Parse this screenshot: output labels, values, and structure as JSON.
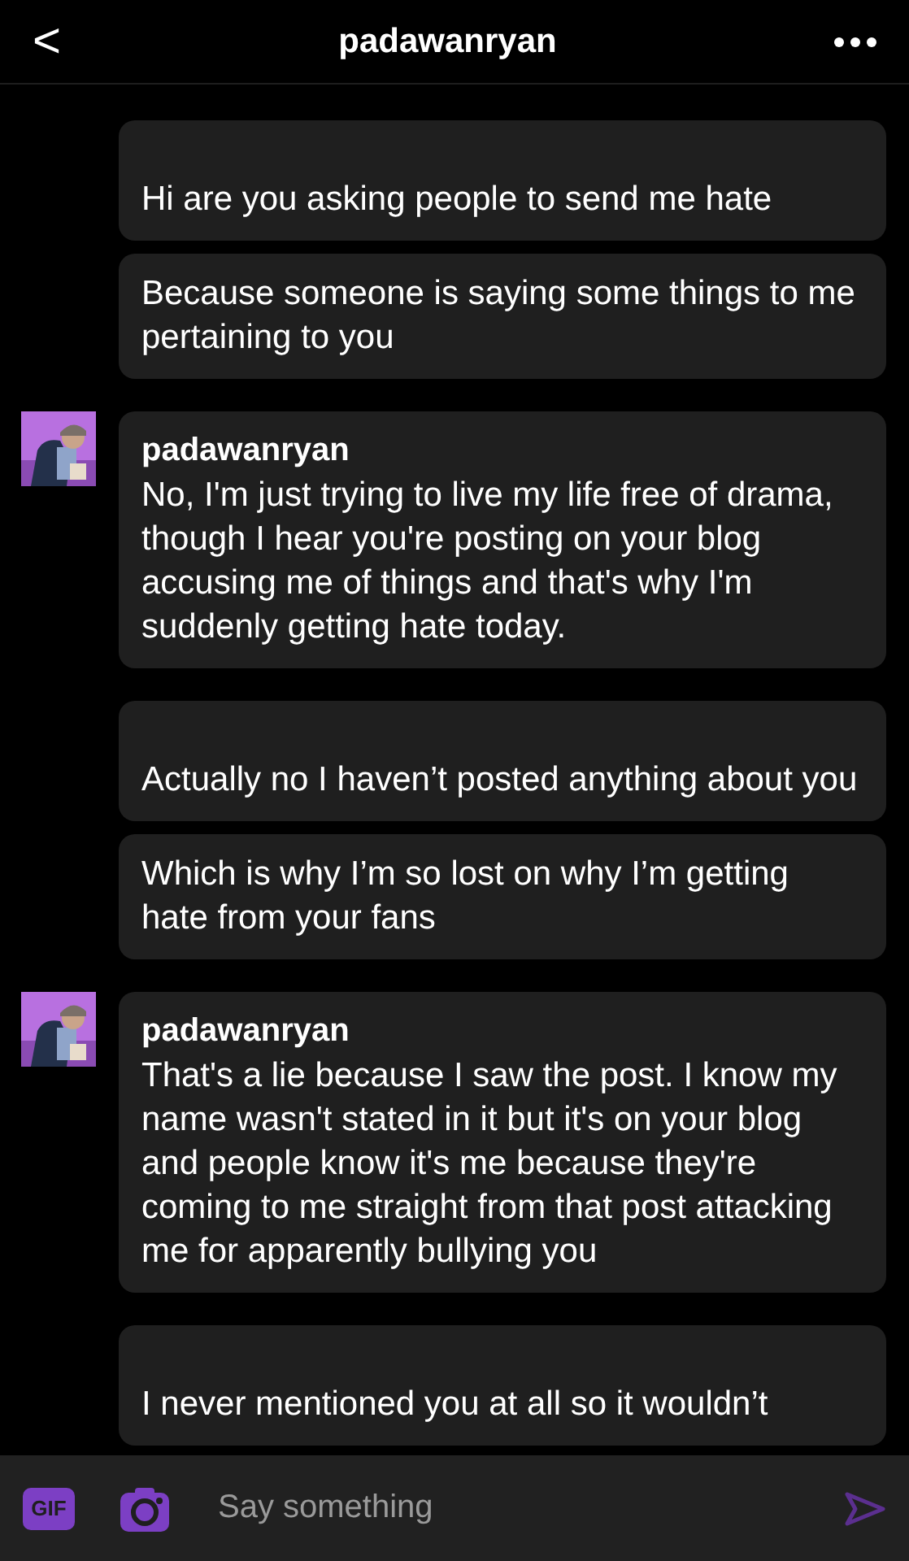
{
  "header": {
    "title": "padawanryan",
    "back": "<"
  },
  "groups": [
    {
      "bubbles": [
        "Hi are you asking people to send me hate",
        "Because someone is saying some things to me pertaining to you"
      ]
    },
    {
      "avatar": {
        "kind": "picture"
      },
      "name": "padawanryan",
      "bubbles": [
        "No, I'm just trying to live my life free of drama, though I hear you're posting on your blog accusing me of things and that's why I'm suddenly getting hate today."
      ]
    },
    {
      "bubbles": [
        "Actually no I haven’t posted anything about you",
        "Which is why I’m so lost on why I’m getting hate from your fans"
      ]
    },
    {
      "avatar": {
        "kind": "picture"
      },
      "name": "padawanryan",
      "bubbles": [
        "That's a lie because I saw the post. I know my name wasn't stated in it but it's on your blog and people know it's me because they're coming to me straight from that post attacking me for apparently bullying you"
      ]
    },
    {
      "bubbles": [
        "I never mentioned you at all so it wouldn’t"
      ]
    }
  ],
  "composer": {
    "gif": "GIF",
    "placeholder": "Say something"
  }
}
